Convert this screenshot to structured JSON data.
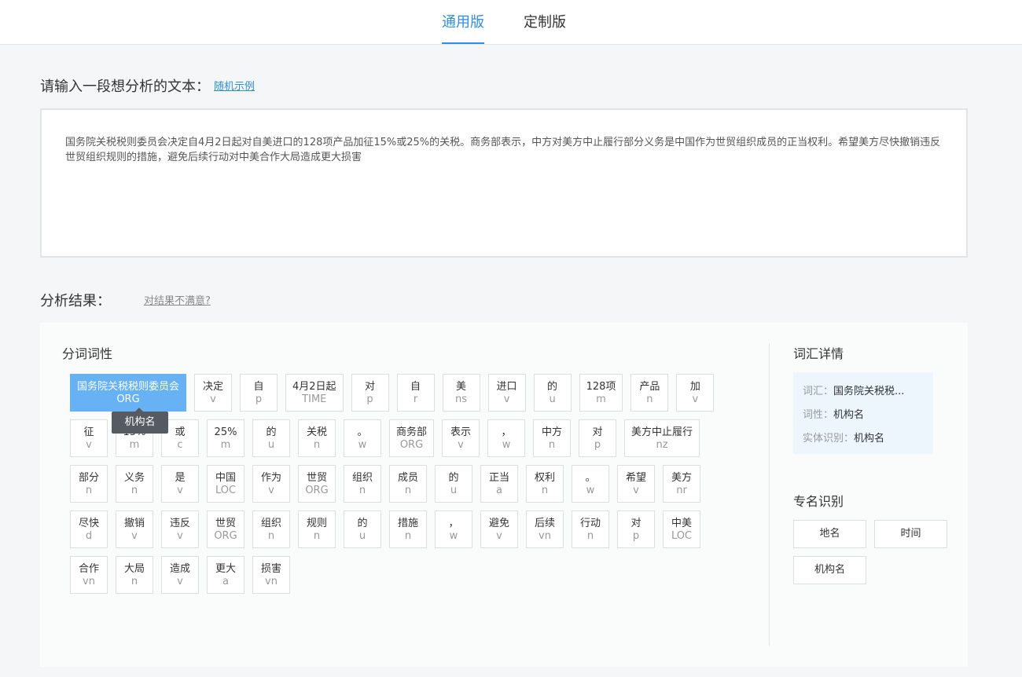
{
  "tabs": {
    "general": "通用版",
    "custom": "定制版"
  },
  "input": {
    "label": "请输入一段想分析的文本：",
    "random_link": "随机示例",
    "text": "国务院关税税则委员会决定自4月2日起对自美进口的128项产品加征15%或25%的关税。商务部表示，中方对美方中止履行部分义务是中国作为世贸组织成员的正当权利。希望美方尽快撤销违反世贸组织规则的措施，避免后续行动对中美合作大局造成更大损害"
  },
  "result": {
    "label": "分析结果：",
    "unsatisfied_link": "对结果不满意?"
  },
  "segmentation": {
    "title": "分词词性",
    "tooltip": "机构名",
    "tokens": [
      {
        "w": "国务院关税税则委员会",
        "t": "ORG"
      },
      {
        "w": "决定",
        "t": "v"
      },
      {
        "w": "自",
        "t": "p"
      },
      {
        "w": "4月2日起",
        "t": "TIME"
      },
      {
        "w": "对",
        "t": "p"
      },
      {
        "w": "自",
        "t": "r"
      },
      {
        "w": "美",
        "t": "ns"
      },
      {
        "w": "进口",
        "t": "v"
      },
      {
        "w": "的",
        "t": "u"
      },
      {
        "w": "128项",
        "t": "m"
      },
      {
        "w": "产品",
        "t": "n"
      },
      {
        "w": "加",
        "t": "v"
      },
      {
        "w": "征",
        "t": "v"
      },
      {
        "w": "15%",
        "t": "m"
      },
      {
        "w": "或",
        "t": "c"
      },
      {
        "w": "25%",
        "t": "m"
      },
      {
        "w": "的",
        "t": "u"
      },
      {
        "w": "关税",
        "t": "n"
      },
      {
        "w": "。",
        "t": "w"
      },
      {
        "w": "商务部",
        "t": "ORG"
      },
      {
        "w": "表示",
        "t": "v"
      },
      {
        "w": "，",
        "t": "w"
      },
      {
        "w": "中方",
        "t": "n"
      },
      {
        "w": "对",
        "t": "p"
      },
      {
        "w": "美方中止履行",
        "t": "nz"
      },
      {
        "w": "部分",
        "t": "n"
      },
      {
        "w": "义务",
        "t": "n"
      },
      {
        "w": "是",
        "t": "v"
      },
      {
        "w": "中国",
        "t": "LOC"
      },
      {
        "w": "作为",
        "t": "v"
      },
      {
        "w": "世贸",
        "t": "ORG"
      },
      {
        "w": "组织",
        "t": "n"
      },
      {
        "w": "成员",
        "t": "n"
      },
      {
        "w": "的",
        "t": "u"
      },
      {
        "w": "正当",
        "t": "a"
      },
      {
        "w": "权利",
        "t": "n"
      },
      {
        "w": "。",
        "t": "w"
      },
      {
        "w": "希望",
        "t": "v"
      },
      {
        "w": "美方",
        "t": "nr"
      },
      {
        "w": "尽快",
        "t": "d"
      },
      {
        "w": "撤销",
        "t": "v"
      },
      {
        "w": "违反",
        "t": "v"
      },
      {
        "w": "世贸",
        "t": "ORG"
      },
      {
        "w": "组织",
        "t": "n"
      },
      {
        "w": "规则",
        "t": "n"
      },
      {
        "w": "的",
        "t": "u"
      },
      {
        "w": "措施",
        "t": "n"
      },
      {
        "w": "，",
        "t": "w"
      },
      {
        "w": "避免",
        "t": "v"
      },
      {
        "w": "后续",
        "t": "vn"
      },
      {
        "w": "行动",
        "t": "n"
      },
      {
        "w": "对",
        "t": "p"
      },
      {
        "w": "中美",
        "t": "LOC"
      },
      {
        "w": "合作",
        "t": "vn"
      },
      {
        "w": "大局",
        "t": "n"
      },
      {
        "w": "造成",
        "t": "v"
      },
      {
        "w": "更大",
        "t": "a"
      },
      {
        "w": "损害",
        "t": "vn"
      }
    ]
  },
  "detail": {
    "title": "词汇详情",
    "word_key": "词汇：",
    "word_val": "国务院关税税...",
    "pos_key": "词性：",
    "pos_val": "机构名",
    "ner_key": "实体识别：",
    "ner_val": "机构名"
  },
  "ner": {
    "title": "专名识别",
    "loc": "地名",
    "time": "时间",
    "org": "机构名"
  },
  "colors": {
    "accent": "#2f8fe0",
    "selected_token": "#67b2f4",
    "detail_bg": "#edf5fd"
  }
}
